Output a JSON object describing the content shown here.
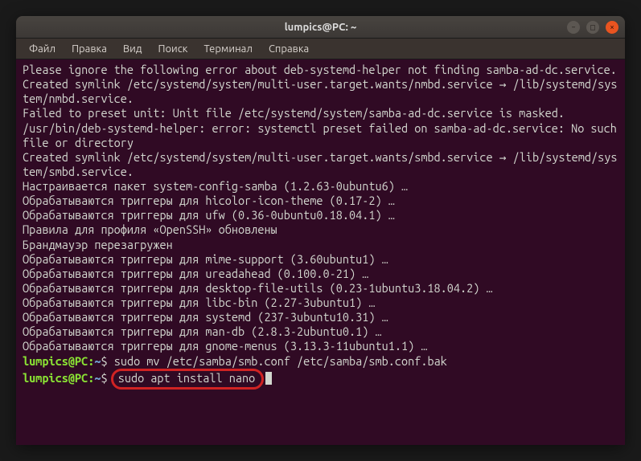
{
  "window": {
    "title": "lumpics@PC: ~"
  },
  "menu": {
    "file": "Файл",
    "edit": "Правка",
    "view": "Вид",
    "search": "Поиск",
    "terminal": "Терминал",
    "help": "Справка"
  },
  "output": {
    "l1": "Please ignore the following error about deb-systemd-helper not finding samba-ad-dc.service.",
    "l2": "Created symlink /etc/systemd/system/multi-user.target.wants/nmbd.service → /lib/systemd/system/nmbd.service.",
    "l3": "Failed to preset unit: Unit file /etc/systemd/system/samba-ad-dc.service is masked.",
    "l4": "/usr/bin/deb-systemd-helper: error: systemctl preset failed on samba-ad-dc.service: No such file or directory",
    "l5": "Created symlink /etc/systemd/system/multi-user.target.wants/smbd.service → /lib/systemd/system/smbd.service.",
    "l6": "Настраивается пакет system-config-samba (1.2.63-0ubuntu6) …",
    "l7": "Обрабатываются триггеры для hicolor-icon-theme (0.17-2) …",
    "l8": "Обрабатываются триггеры для ufw (0.36-0ubuntu0.18.04.1) …",
    "l9": "Правила для профиля «OpenSSH» обновлены",
    "l10": "Брандмауэр перезагружен",
    "l11": "Обрабатываются триггеры для mime-support (3.60ubuntu1) …",
    "l12": "Обрабатываются триггеры для ureadahead (0.100.0-21) …",
    "l13": "Обрабатываются триггеры для desktop-file-utils (0.23-1ubuntu3.18.04.2) …",
    "l14": "Обрабатываются триггеры для libc-bin (2.27-3ubuntu1) …",
    "l15": "Обрабатываются триггеры для systemd (237-3ubuntu10.31) …",
    "l16": "Обрабатываются триггеры для man-db (2.8.3-2ubuntu0.1) …",
    "l17": "Обрабатываются триггеры для gnome-menus (3.13.3-11ubuntu1.1) …"
  },
  "prompt1": {
    "user": "lumpics@PC",
    "colon": ":",
    "path": "~",
    "dollar": "$ ",
    "cmd": "sudo mv /etc/samba/smb.conf /etc/samba/smb.conf.bak"
  },
  "prompt2": {
    "user": "lumpics@PC",
    "colon": ":",
    "path": "~",
    "dollar": "$ ",
    "cmd": "sudo apt install nano"
  }
}
